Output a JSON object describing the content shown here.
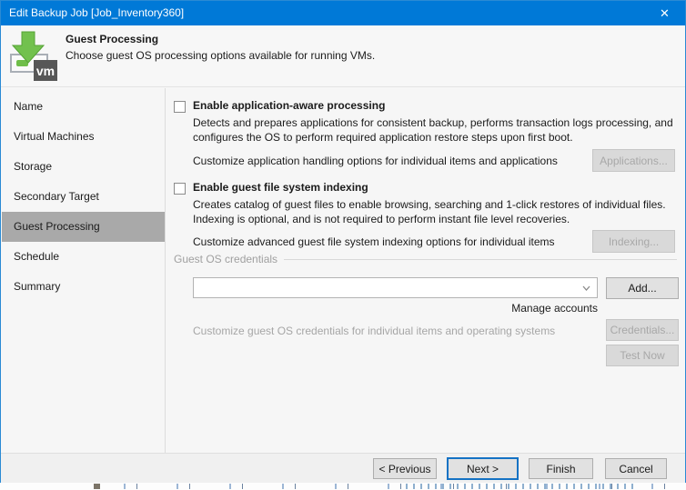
{
  "window": {
    "title": "Edit Backup Job [Job_Inventory360]",
    "close_glyph": "✕"
  },
  "header": {
    "title": "Guest Processing",
    "subtitle": "Choose guest OS processing options available for running VMs.",
    "icon_label": "vm"
  },
  "sidebar": {
    "items": [
      {
        "label": "Name",
        "selected": false
      },
      {
        "label": "Virtual Machines",
        "selected": false
      },
      {
        "label": "Storage",
        "selected": false
      },
      {
        "label": "Secondary Target",
        "selected": false
      },
      {
        "label": "Guest Processing",
        "selected": true
      },
      {
        "label": "Schedule",
        "selected": false
      },
      {
        "label": "Summary",
        "selected": false
      }
    ]
  },
  "content": {
    "app_aware": {
      "checkbox_label": "Enable application-aware processing",
      "checked": false,
      "description": "Detects and prepares applications for consistent backup, performs transaction logs processing, and configures the OS to perform required application restore steps upon first boot.",
      "customize_text": "Customize application handling options for individual items and applications",
      "button_label": "Applications...",
      "button_enabled": false
    },
    "file_indexing": {
      "checkbox_label": "Enable guest file system indexing",
      "checked": false,
      "description": "Creates catalog of guest files to enable browsing, searching and 1-click restores of individual files. Indexing is optional, and is not required to perform instant file level recoveries.",
      "customize_text": "Customize advanced guest file system indexing options for individual items",
      "button_label": "Indexing...",
      "button_enabled": false
    },
    "credentials": {
      "group_label": "Guest OS credentials",
      "combo_value": "",
      "add_button_label": "Add...",
      "manage_accounts_label": "Manage accounts",
      "customize_text": "Customize guest OS credentials for individual items and operating systems",
      "credentials_button_label": "Credentials...",
      "test_button_label": "Test Now",
      "buttons_enabled": false
    }
  },
  "footer": {
    "previous_label": "< Previous",
    "next_label": "Next >",
    "finish_label": "Finish",
    "cancel_label": "Cancel"
  },
  "colors": {
    "titlebar": "#0079d7",
    "accent_border": "#2a8ad4",
    "sidebar_selected": "#a9a9a9",
    "disabled_text": "#a6a6a6",
    "icon_green": "#6fbe49"
  }
}
